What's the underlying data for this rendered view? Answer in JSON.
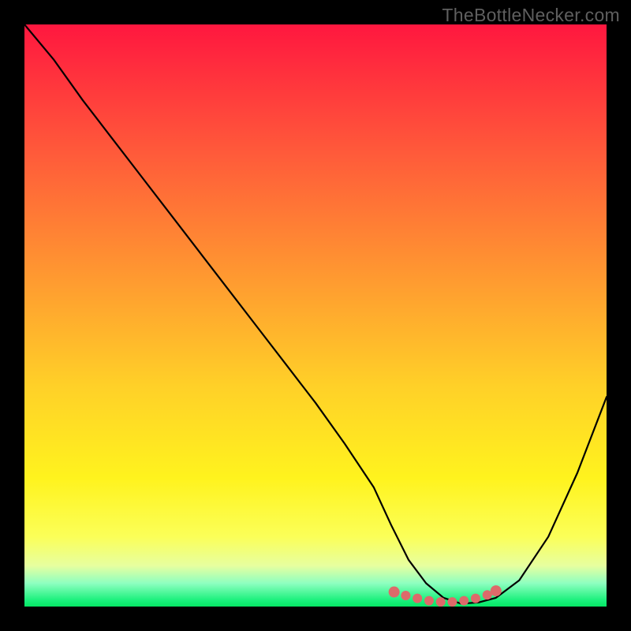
{
  "watermark": "TheBottleNecker.com",
  "chart_data": {
    "type": "line",
    "title": "",
    "xlabel": "",
    "ylabel": "",
    "xlim": [
      0,
      100
    ],
    "ylim": [
      0,
      100
    ],
    "series": [
      {
        "name": "bottleneck-curve",
        "x": [
          0,
          5,
          10,
          15,
          20,
          25,
          30,
          35,
          40,
          45,
          50,
          55,
          60,
          63,
          66,
          69,
          72,
          75,
          78,
          81,
          85,
          90,
          95,
          100
        ],
        "y": [
          100,
          94,
          87,
          80.5,
          74,
          67.5,
          61,
          54.5,
          48,
          41.5,
          35,
          28,
          20.5,
          14,
          8,
          4,
          1.5,
          0.5,
          0.7,
          1.5,
          4.5,
          12,
          23,
          36
        ],
        "color": "#000000"
      }
    ],
    "markers": {
      "name": "optimal-range",
      "color": "#dd6a6a",
      "points": [
        {
          "x": 63.5,
          "y": 2.5
        },
        {
          "x": 65.5,
          "y": 1.9
        },
        {
          "x": 67.5,
          "y": 1.4
        },
        {
          "x": 69.5,
          "y": 1.0
        },
        {
          "x": 71.5,
          "y": 0.8
        },
        {
          "x": 73.5,
          "y": 0.8
        },
        {
          "x": 75.5,
          "y": 1.0
        },
        {
          "x": 77.5,
          "y": 1.4
        },
        {
          "x": 79.5,
          "y": 2.0
        },
        {
          "x": 81.0,
          "y": 2.7
        }
      ]
    },
    "background_gradient": {
      "top": "#ff173f",
      "middle": "#fff31e",
      "bottom": "#18f07a"
    }
  }
}
